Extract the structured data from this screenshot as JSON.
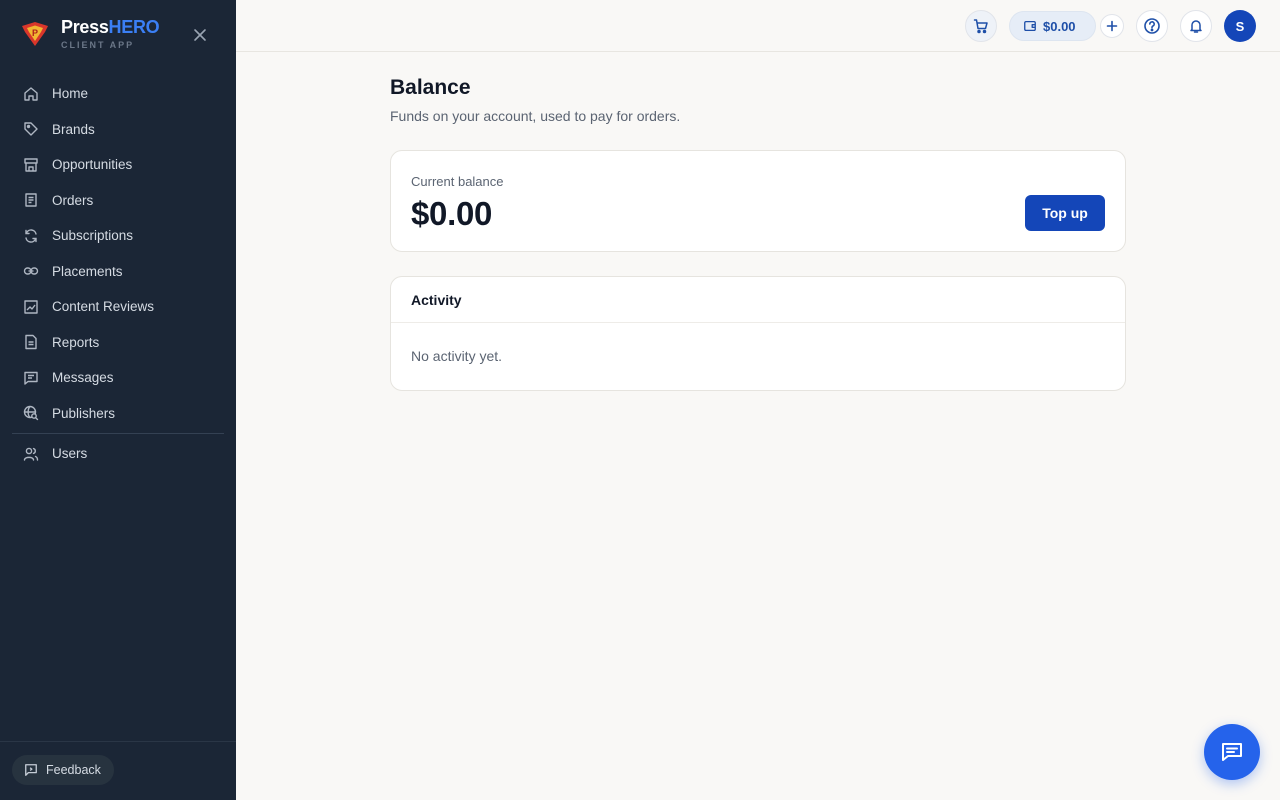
{
  "brand": {
    "name_main": "Press",
    "name_accent": "HERO",
    "subtitle": "CLIENT APP"
  },
  "sidebar": {
    "items": [
      {
        "label": "Home",
        "icon": "home-icon"
      },
      {
        "label": "Brands",
        "icon": "tag-icon"
      },
      {
        "label": "Opportunities",
        "icon": "storefront-icon"
      },
      {
        "label": "Orders",
        "icon": "receipt-icon"
      },
      {
        "label": "Subscriptions",
        "icon": "refresh-icon"
      },
      {
        "label": "Placements",
        "icon": "link-icon"
      },
      {
        "label": "Content Reviews",
        "icon": "image-review-icon"
      },
      {
        "label": "Reports",
        "icon": "document-icon"
      },
      {
        "label": "Messages",
        "icon": "message-icon"
      },
      {
        "label": "Publishers",
        "icon": "globe-search-icon"
      }
    ],
    "secondary": [
      {
        "label": "Users",
        "icon": "users-icon"
      }
    ],
    "feedback_label": "Feedback"
  },
  "topbar": {
    "balance": "$0.00",
    "avatar_initial": "S"
  },
  "main": {
    "title": "Balance",
    "subtitle": "Funds on your account, used to pay for orders.",
    "balance_card": {
      "caption": "Current balance",
      "amount": "$0.00",
      "button": "Top up"
    },
    "activity": {
      "title": "Activity",
      "empty": "No activity yet."
    }
  },
  "colors": {
    "sidebar_bg": "#1b2636",
    "primary": "#1446b8",
    "accent": "#3b7ff5",
    "fab": "#2563eb"
  }
}
